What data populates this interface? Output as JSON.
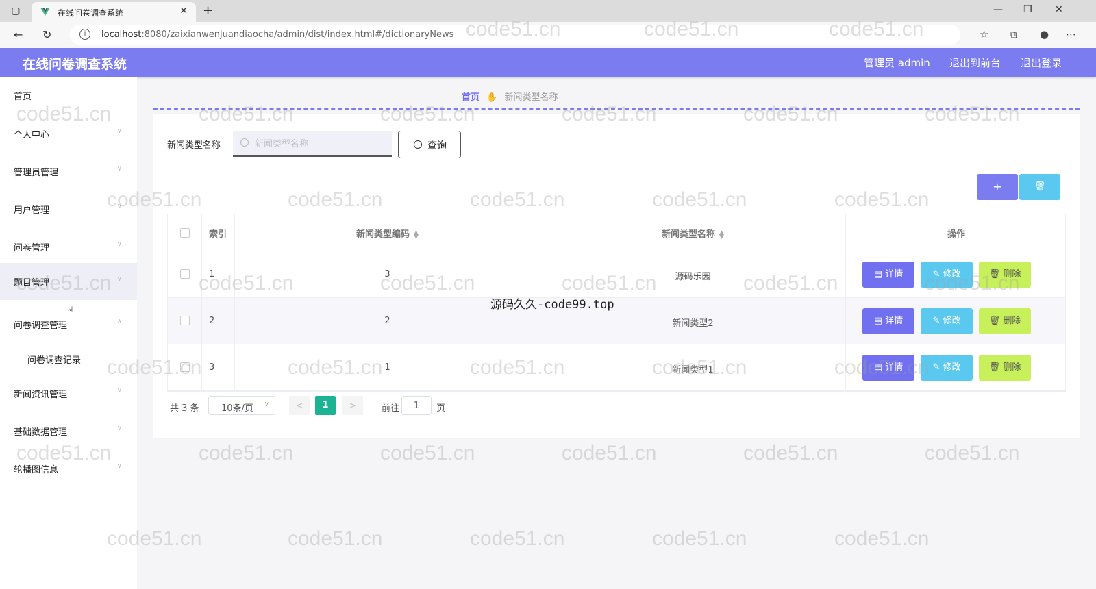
{
  "browser": {
    "tab_title": "在线问卷调查系统",
    "url_host": "localhost",
    "url_rest": ":8080/zaixianwenjuandiaocha/admin/dist/index.html#/dictionaryNews"
  },
  "header": {
    "title": "在线问卷调查系统",
    "user": "管理员 admin",
    "to_front": "退出到前台",
    "logout": "退出登录"
  },
  "sidebar": {
    "items": [
      {
        "label": "首页"
      },
      {
        "label": "个人中心"
      },
      {
        "label": "管理员管理"
      },
      {
        "label": "用户管理"
      },
      {
        "label": "问卷管理"
      },
      {
        "label": "题目管理"
      },
      {
        "label": "问卷调查管理"
      },
      {
        "label": "问卷调查记录"
      },
      {
        "label": "新闻资讯管理"
      },
      {
        "label": "基础数据管理"
      },
      {
        "label": "轮播图信息"
      }
    ]
  },
  "breadcrumb": {
    "home": "首页",
    "current": "新闻类型名称"
  },
  "search": {
    "label": "新闻类型名称",
    "placeholder": "新闻类型名称",
    "value": "",
    "query_label": "查询"
  },
  "toolbar": {
    "add_label": "+",
    "delete_label": "🗑"
  },
  "table": {
    "headers": [
      "索引",
      "新闻类型编码",
      "新闻类型名称",
      "操作"
    ],
    "rows": [
      {
        "index": "1",
        "code": "3",
        "name": "源码乐园"
      },
      {
        "index": "2",
        "code": "2",
        "name": "新闻类型2"
      },
      {
        "index": "3",
        "code": "1",
        "name": "新闻类型1"
      }
    ],
    "actions": {
      "detail": "详情",
      "edit": "修改",
      "delete": "删除"
    }
  },
  "pagination": {
    "total": "共 3 条",
    "page_size": "10条/页",
    "current_page": "1",
    "goto_label": "前往",
    "goto_value": "1",
    "page_suffix": "页"
  },
  "watermarks": {
    "repeat_text": "code51.cn",
    "center_text": "源码久久-code99.top"
  },
  "colors": {
    "primary": "#7b7cf0",
    "info": "#5bc8f0",
    "warning_lime": "#c8f05a",
    "pager_active": "#1ab394"
  }
}
